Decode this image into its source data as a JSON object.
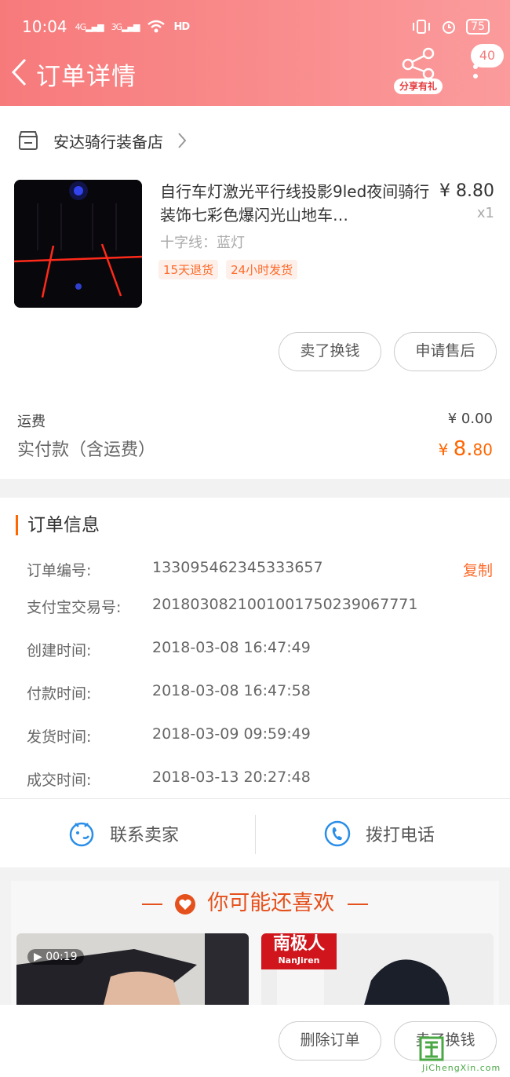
{
  "status_bar": {
    "time": "10:04",
    "network_1": "4G",
    "network_2": "3G",
    "hd": "HD",
    "battery": "75"
  },
  "nav": {
    "title": "订单详情",
    "share_label": "分享有礼",
    "notification_count": "40"
  },
  "shop": {
    "name": "安达骑行装备店"
  },
  "product": {
    "title": "自行车灯激光平行线投影9led夜间骑行装饰七彩色爆闪光山地车…",
    "price": "¥ 8.80",
    "quantity": "x1",
    "spec": "十字线：蓝灯",
    "tags": [
      "15天退货",
      "24小时发货"
    ]
  },
  "item_buttons": {
    "sell": "卖了换钱",
    "after_sale": "申请售后"
  },
  "summary": {
    "shipping_label": "运费",
    "shipping_value": "¥ 0.00",
    "total_label": "实付款（含运费）",
    "total_currency": "¥ ",
    "total_integer": "8.",
    "total_decimal": "80"
  },
  "order_info": {
    "title": "订单信息",
    "copy_label": "复制",
    "rows": [
      {
        "key": "订单编号:",
        "value": "133095462345333657"
      },
      {
        "key": "支付宝交易号:",
        "value": "2018030821001001750239067771"
      },
      {
        "key": "创建时间:",
        "value": "2018-03-08  16:47:49"
      },
      {
        "key": "付款时间:",
        "value": "2018-03-08  16:47:58"
      },
      {
        "key": "发货时间:",
        "value": "2018-03-09  09:59:49"
      },
      {
        "key": "成交时间:",
        "value": "2018-03-13  20:27:48"
      }
    ]
  },
  "contact": {
    "seller": "联系卖家",
    "phone": "拨打电话"
  },
  "recommend": {
    "title": "你可能还喜欢",
    "video_duration": "00:19",
    "brand_cn": "南极人",
    "brand_en": "NanJiren"
  },
  "bottom_bar": {
    "delete": "删除订单",
    "sell": "卖了换钱"
  },
  "watermark": {
    "text": "JiChengXin.com"
  },
  "colors": {
    "accent": "#ff6600",
    "header": "#f77a7b",
    "tag_bg": "#fdf0ea"
  }
}
